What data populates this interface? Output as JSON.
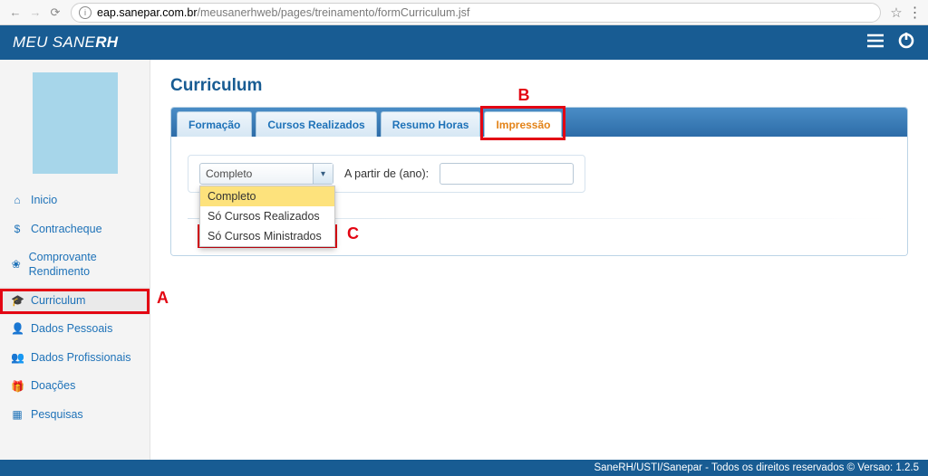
{
  "browser": {
    "url_host": "eap.sanepar.com.br",
    "url_path": "/meusanerhweb/pages/treinamento/formCurriculum.jsf"
  },
  "app": {
    "logo_prefix": "MEU SANE",
    "logo_suffix": "RH"
  },
  "sidebar": {
    "items": [
      {
        "icon": "home-icon",
        "glyph": "⌂",
        "label": "Inicio"
      },
      {
        "icon": "dollar-icon",
        "glyph": "$",
        "label": "Contracheque"
      },
      {
        "icon": "paw-icon",
        "glyph": "❀",
        "label": "Comprovante Rendimento"
      },
      {
        "icon": "graduation-icon",
        "glyph": "🎓",
        "label": "Curriculum"
      },
      {
        "icon": "user-icon",
        "glyph": "👤",
        "label": "Dados Pessoais"
      },
      {
        "icon": "users-icon",
        "glyph": "👥",
        "label": "Dados Profissionais"
      },
      {
        "icon": "gift-icon",
        "glyph": "🎁",
        "label": "Doações"
      },
      {
        "icon": "calendar-icon",
        "glyph": "▦",
        "label": "Pesquisas"
      }
    ]
  },
  "page": {
    "title": "Curriculum",
    "tabs": [
      {
        "label": "Formação"
      },
      {
        "label": "Cursos Realizados"
      },
      {
        "label": "Resumo Horas"
      },
      {
        "label": "Impressão"
      }
    ],
    "filters": {
      "combo_value": "Completo",
      "combo_options": [
        "Completo",
        "Só Cursos Realizados",
        "Só Cursos Ministrados"
      ],
      "year_label": "A partir de (ano):",
      "year_value": ""
    }
  },
  "callouts": {
    "a": "A",
    "b": "B",
    "c": "C"
  },
  "footer": "SaneRH/USTI/Sanepar - Todos os direitos reservados © Versao: 1.2.5"
}
